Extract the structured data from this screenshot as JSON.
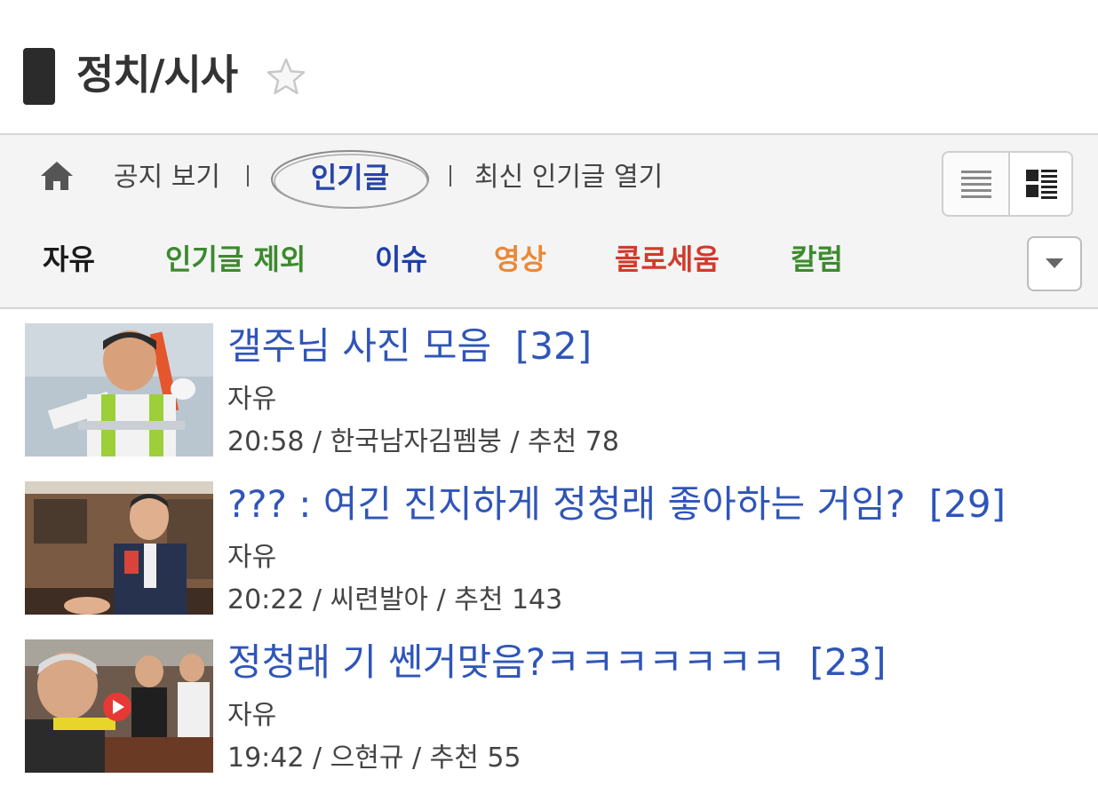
{
  "board": {
    "title": "정치/시사"
  },
  "nav": {
    "notice_label": "공지 보기",
    "popular_label": "인기글",
    "latest_popular_label": "최신 인기글 열기"
  },
  "categories": [
    {
      "label": "자유",
      "color": "#1a1a1a"
    },
    {
      "label": "인기글 제외",
      "color": "#3c8a2e"
    },
    {
      "label": "이슈",
      "color": "#1f3ea8"
    },
    {
      "label": "영상",
      "color": "#e8893a"
    },
    {
      "label": "콜로세움",
      "color": "#d23a2a"
    },
    {
      "label": "칼럼",
      "color": "#3c8a2e"
    }
  ],
  "posts": [
    {
      "title": "갤주님 사진 모음",
      "comments": "[32]",
      "category": "자유",
      "meta": "20:58 / 한국남자김펨붕 / 추천 78"
    },
    {
      "title": "??? : 여긴 진지하게 정청래 좋아하는 거임?",
      "comments": "[29]",
      "category": "자유",
      "meta": "20:22 / 씨련발아 / 추천 143"
    },
    {
      "title": "정청래 기 쎈거맞음?ㅋㅋㅋㅋㅋㅋㅋ",
      "comments": "[23]",
      "category": "자유",
      "meta": "19:42 / 으현규 / 추천 55"
    }
  ],
  "colors": {
    "accent": "#2f55b8",
    "popular": "#2846a8",
    "header_bar": "#2b2b2b"
  },
  "icons": {
    "favorite": "star-icon",
    "home": "home-icon",
    "list_view": "list-view-icon",
    "thumb_view": "thumbnail-view-icon",
    "dropdown": "chevron-down-icon",
    "video": "play-icon"
  }
}
